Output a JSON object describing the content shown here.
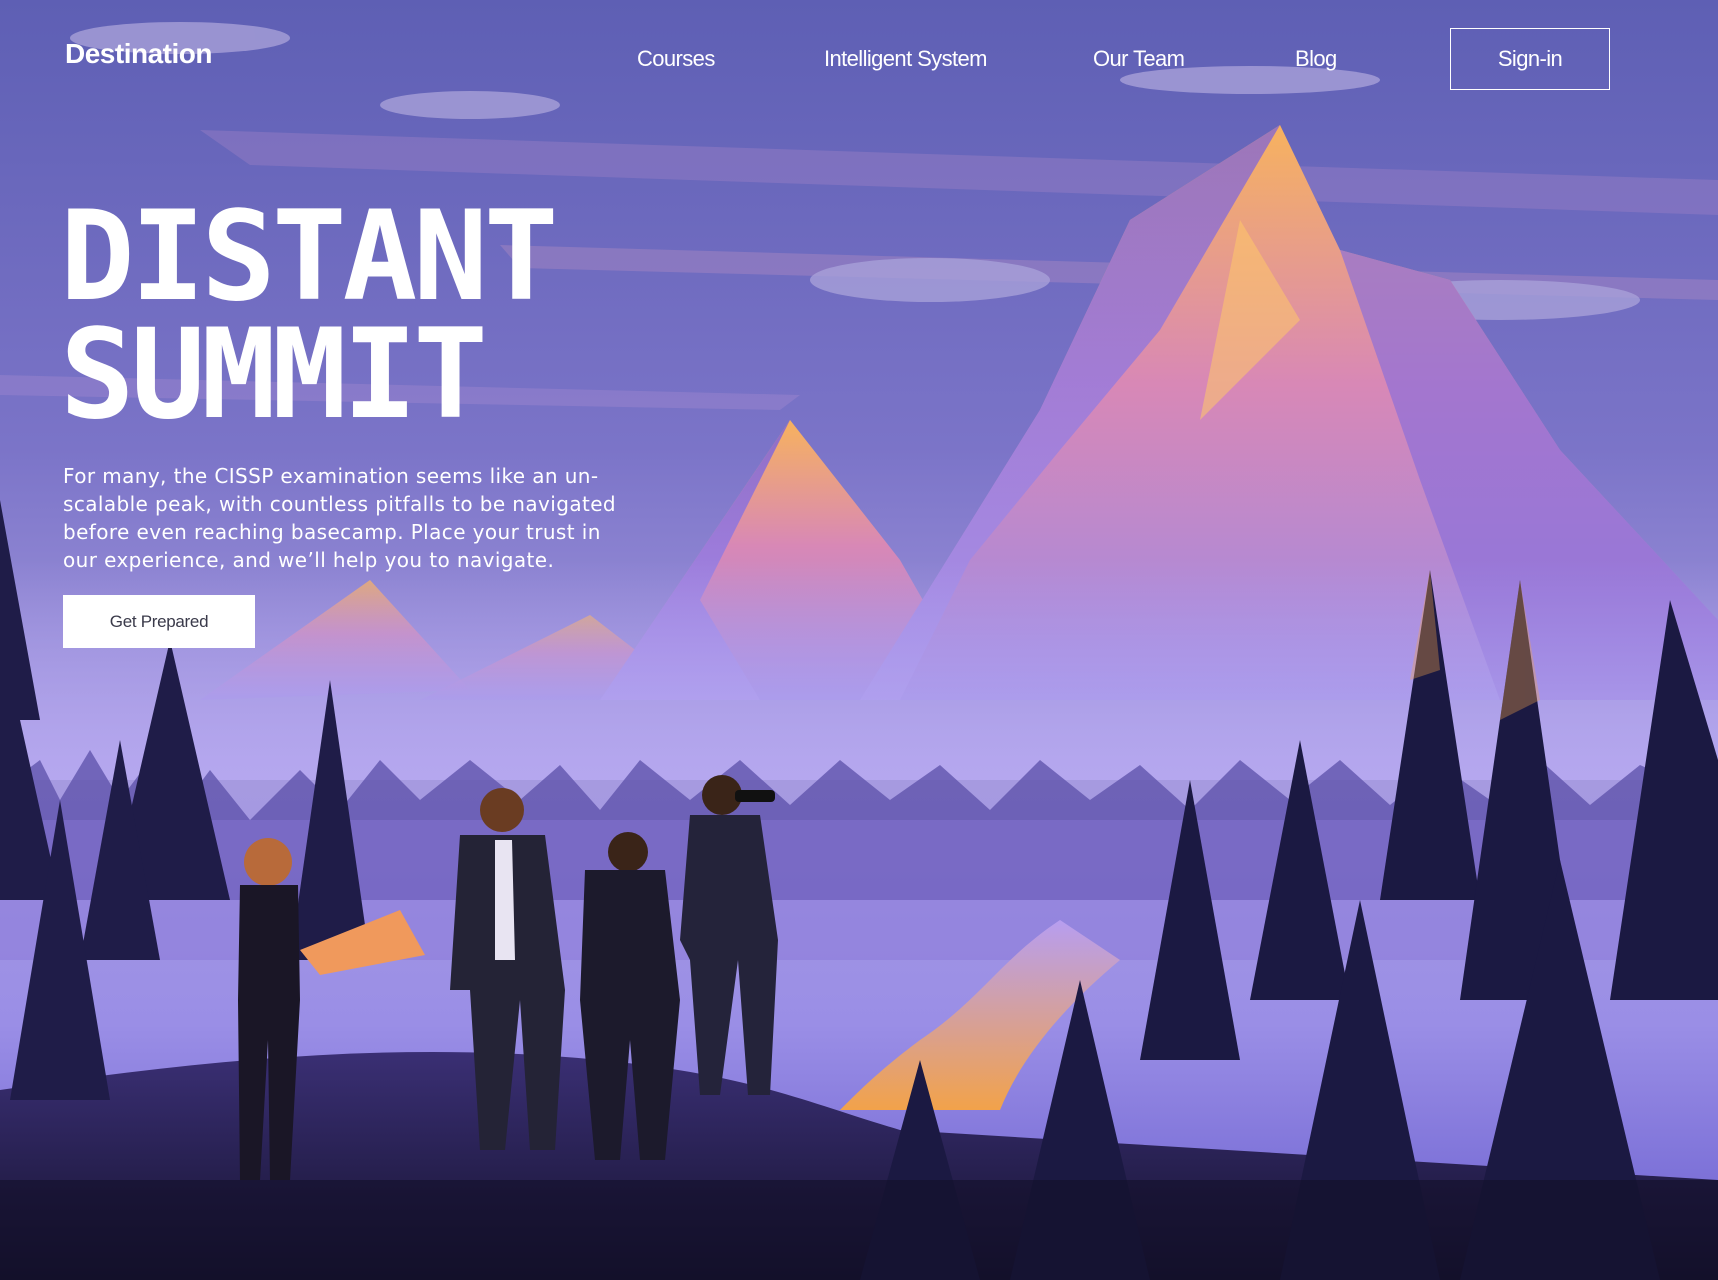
{
  "brand": {
    "logo_text": "Destination"
  },
  "nav": {
    "items": [
      {
        "label": "Courses"
      },
      {
        "label": "Intelligent System"
      },
      {
        "label": "Our Team"
      },
      {
        "label": "Blog"
      }
    ],
    "signin_label": "Sign-in"
  },
  "hero": {
    "title_line1": "DISTANT",
    "title_line2": "SUMMIT",
    "body": "For many, the CISSP examination seems like an un-scalable peak, with countless pitfalls to be navigated before even reaching basecamp. Place your trust in our experience, and we’ll help you to navigate.",
    "cta_label": "Get Prepared"
  },
  "colors": {
    "sky_top": "#6a66c0",
    "sky_mid": "#8a86d4",
    "mountain_light": "#f6a85a",
    "mountain_shadow": "#7a6ad8",
    "forest_dark": "#1c1a3e",
    "river_glow": "#f2a24a",
    "text": "#ffffff",
    "cta_bg": "#ffffff"
  },
  "illustration": {
    "subject": "mountain-landscape-with-hikers",
    "icons": [
      "binoculars-icon",
      "map-icon"
    ]
  }
}
